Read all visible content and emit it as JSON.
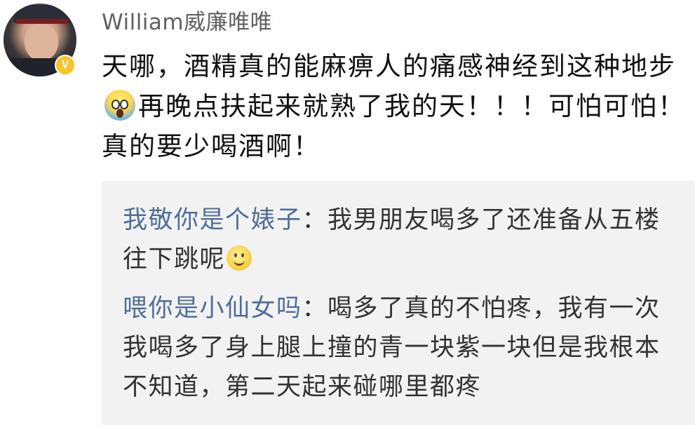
{
  "post": {
    "username": "William威廉唯唯",
    "verified_badge": "V",
    "text_part1": "天哪，酒精真的能麻痹人的痛感神经到这种地步",
    "emoji1": "scream-emoji",
    "text_part2": "再晚点扶起来就熟了我的天！！！可怕可怕！真的要少喝酒啊！"
  },
  "replies": [
    {
      "name": "我敬你是个婊子",
      "separator": "：",
      "text": "我男朋友喝多了还准备从五楼往下跳呢",
      "emoji": "smile-emoji"
    },
    {
      "name": "喂你是小仙女吗",
      "separator": "：",
      "text": "喝多了真的不怕疼，我有一次我喝多了身上腿上撞的青一块紫一块但是我根本不知道，第二天起来碰哪里都疼"
    }
  ],
  "colors": {
    "reply_name": "#4f6f99",
    "reply_box_bg": "#f2f2f2",
    "username": "#616161",
    "badge": "#f7c52b"
  }
}
